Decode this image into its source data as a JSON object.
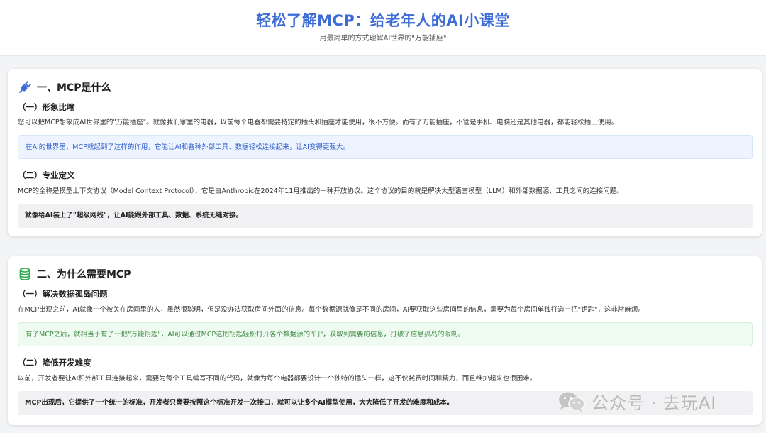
{
  "header": {
    "title": "轻松了解MCP：给老年人的AI小课堂",
    "subtitle": "用最简单的方式理解AI世界的\"万能插座\""
  },
  "sections": [
    {
      "title": "一、MCP是什么",
      "icon": "plug-icon",
      "subsections": [
        {
          "title": "（一）形象比喻",
          "text": "您可以把MCP想象成AI世界里的\"万能插座\"。就像我们家里的电器，以前每个电器都需要特定的插头和插座才能使用，很不方便。而有了万能插座，不管是手机、电脑还是其他电器，都能轻松插上使用。",
          "callout": "在AI的世界里，MCP就起到了这样的作用，它能让AI和各种外部工具、数据轻松连接起来，让AI变得更强大。"
        },
        {
          "title": "（二）专业定义",
          "text": "MCP的全称是模型上下文协议（Model Context Protocol），它是由Anthropic在2024年11月推出的一种开放协议。这个协议的目的就是解决大型语言模型（LLM）和外部数据源、工具之间的连接问题。",
          "callout": "就像给AI装上了\"超级网线\"，让AI能跟外部工具、数据、系统无缝对接。"
        }
      ]
    },
    {
      "title": "二、为什么需要MCP",
      "icon": "database-icon",
      "subsections": [
        {
          "title": "（一）解决数据孤岛问题",
          "text": "在MCP出现之前，AI就像一个被关在房间里的人，虽然很聪明，但是没办法获取房间外面的信息。每个数据源就像是不同的房间，AI要获取这些房间里的信息，需要为每个房间单独打造一把\"钥匙\"，这非常麻烦。",
          "callout": "有了MCP之后，就相当于有了一把\"万能钥匙\"，AI可以通过MCP这把钥匙轻松打开各个数据源的\"门\"，获取到需要的信息，打破了信息孤岛的限制。"
        },
        {
          "title": "（二）降低开发难度",
          "text": "以前，开发者要让AI和外部工具连接起来，需要为每个工具编写不同的代码，就像为每个电器都要设计一个独特的插头一样，这不仅耗费时间和精力，而且维护起来也很困难。",
          "callout": "MCP出现后，它提供了一个统一的标准，开发者只需要按照这个标准开发一次接口，就可以让多个AI模型使用，大大降低了开发的难度和成本。"
        }
      ]
    }
  ],
  "watermark": {
    "text": "公众号 · 去玩AI",
    "icon": "wechat-icon"
  },
  "colors": {
    "accent": "#3b6bd6",
    "blue_box": "#eef4ff",
    "green_box": "#effaf0",
    "gray_box": "#f1f1f3"
  }
}
